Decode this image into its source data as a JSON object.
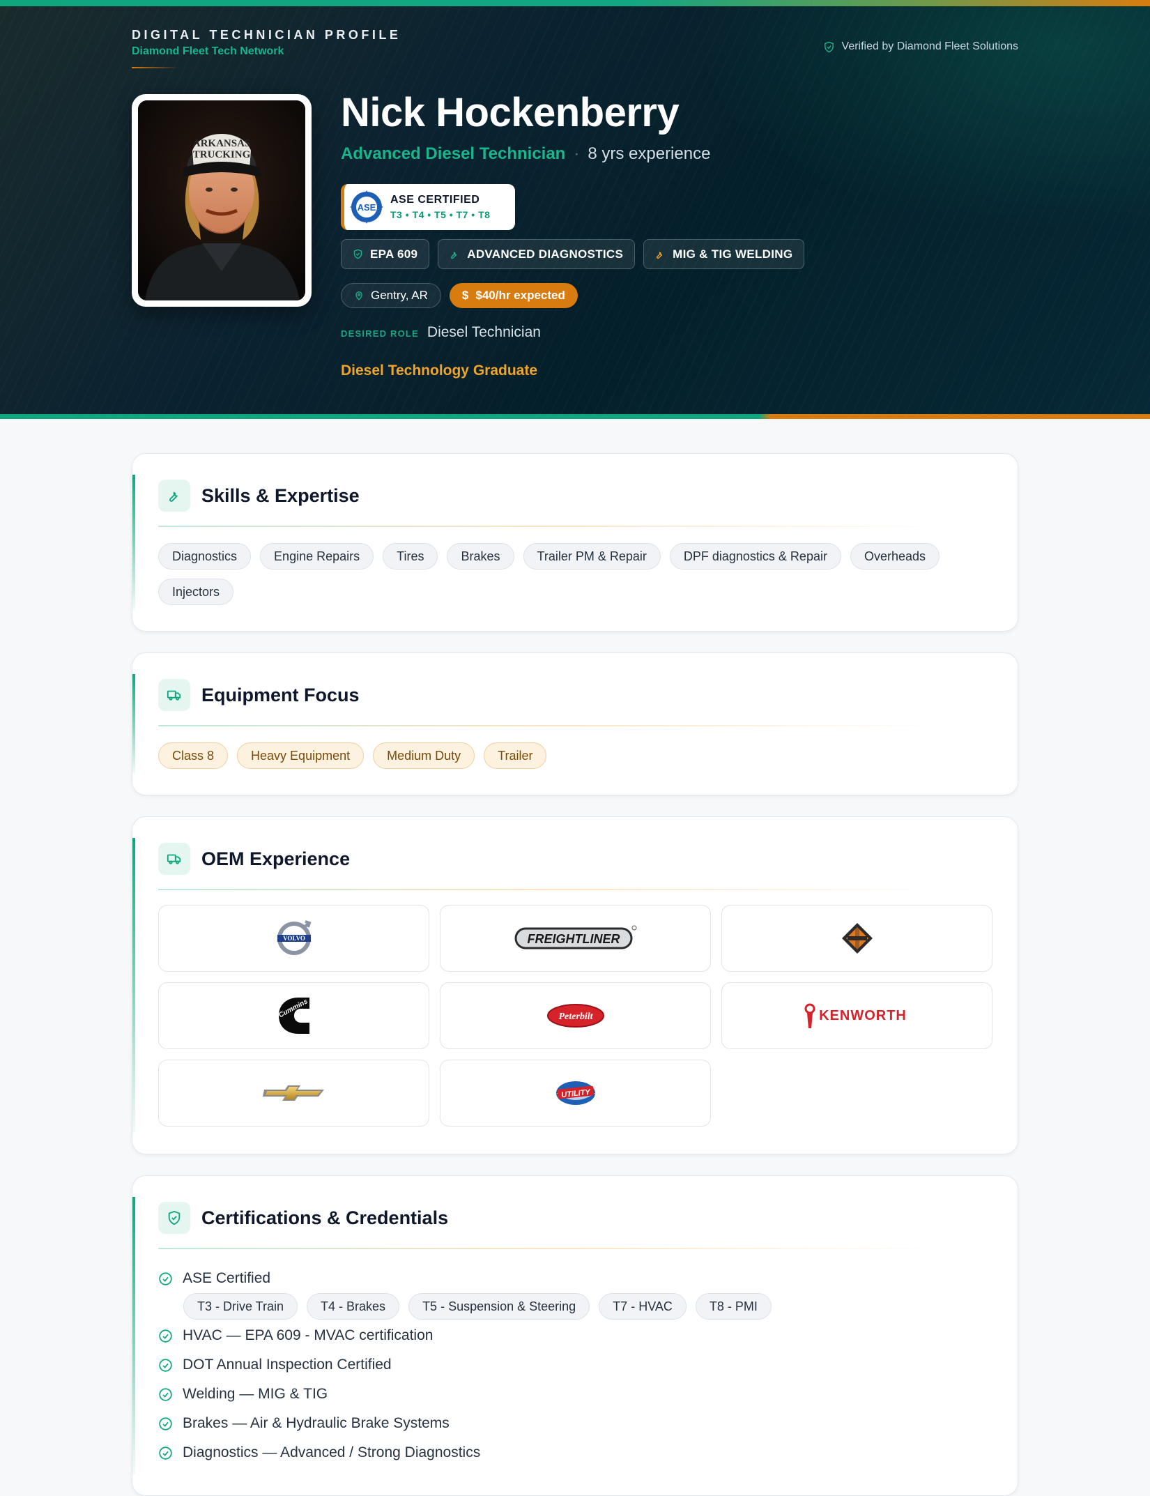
{
  "header": {
    "eyebrow": "DIGITAL TECHNICIAN PROFILE",
    "network": "Diamond Fleet Tech Network",
    "verified": "Verified by Diamond Fleet Solutions"
  },
  "profile": {
    "name": "Nick Hockenberry",
    "role": "Advanced Diesel Technician",
    "experience": "8 yrs experience",
    "ase": {
      "title": "ASE CERTIFIED",
      "tests": "T3 • T4 • T5 • T7 • T8",
      "logo_text": "ASE"
    },
    "badges": [
      {
        "label": "EPA 609",
        "icon": "shield-icon"
      },
      {
        "label": "ADVANCED DIAGNOSTICS",
        "icon": "wrench-icon"
      },
      {
        "label": "MIG & TIG WELDING",
        "icon": "wrench-icon"
      }
    ],
    "location": "Gentry, AR",
    "rate": "$40/hr expected",
    "rate_symbol": "$",
    "desired_role_label": "DESIRED ROLE",
    "desired_role": "Diesel Technician",
    "education": "Diesel Technology Graduate",
    "hat_text_1": "ARKANSAS",
    "hat_text_2": "TRUCKING"
  },
  "skills": {
    "title": "Skills & Expertise",
    "items": [
      "Diagnostics",
      "Engine Repairs",
      "Tires",
      "Brakes",
      "Trailer PM & Repair",
      "DPF diagnostics & Repair",
      "Overheads",
      "Injectors"
    ]
  },
  "equipment": {
    "title": "Equipment Focus",
    "items": [
      "Class 8",
      "Heavy Equipment",
      "Medium Duty",
      "Trailer"
    ]
  },
  "oem": {
    "title": "OEM Experience",
    "logos": [
      {
        "name": "Volvo",
        "text": "VOLVO"
      },
      {
        "name": "Freightliner",
        "text": "FREIGHTLINER"
      },
      {
        "name": "International",
        "text": "INTERNATIONAL"
      },
      {
        "name": "Cummins",
        "text": "Cummins"
      },
      {
        "name": "Peterbilt",
        "text": "Peterbilt"
      },
      {
        "name": "Kenworth",
        "text": "KENWORTH"
      },
      {
        "name": "Chevrolet",
        "text": ""
      },
      {
        "name": "Utility",
        "text": "UTILITY"
      }
    ]
  },
  "certs": {
    "title": "Certifications & Credentials",
    "items": [
      {
        "label": "ASE Certified",
        "sub": [
          "T3 - Drive Train",
          "T4 - Brakes",
          "T5 - Suspension & Steering",
          "T7 - HVAC",
          "T8 - PMI"
        ]
      },
      {
        "label": "HVAC — EPA 609 - MVAC certification"
      },
      {
        "label": "DOT Annual Inspection Certified"
      },
      {
        "label": "Welding — MIG & TIG"
      },
      {
        "label": "Brakes — Air & Hydraulic Brake Systems"
      },
      {
        "label": "Diagnostics — Advanced / Strong Diagnostics"
      }
    ]
  },
  "colors": {
    "accent_green": "#0fa67e",
    "accent_orange": "#d97c0f",
    "hero_bg": "#04202a"
  }
}
